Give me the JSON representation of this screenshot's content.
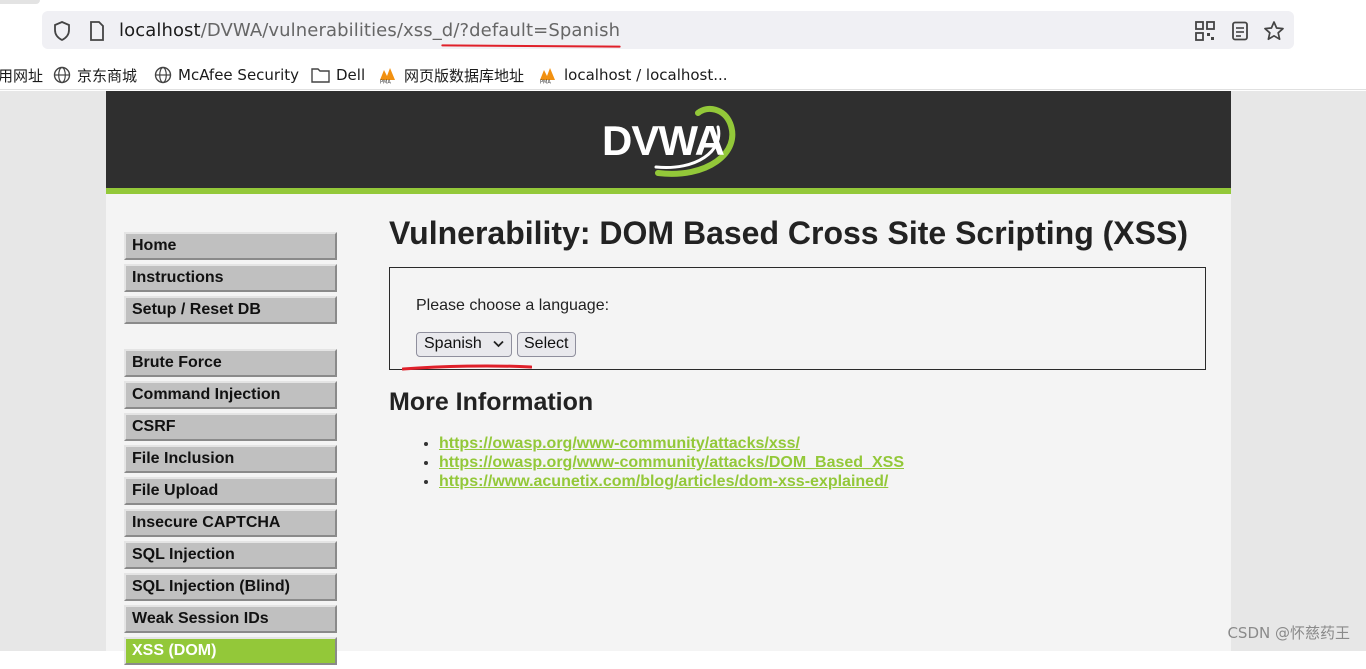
{
  "browser": {
    "url_host": "localhost",
    "url_path": "/DVWA/vulnerabilities/xss_d/?default=Spanish",
    "bookmarks": [
      {
        "label": "用网址",
        "icon": "none"
      },
      {
        "label": "京东商城",
        "icon": "globe-icon"
      },
      {
        "label": "McAfee Security",
        "icon": "globe-icon"
      },
      {
        "label": "Dell",
        "icon": "folder-icon"
      },
      {
        "label": "网页版数据库地址",
        "icon": "pma-icon"
      },
      {
        "label": "localhost / localhost...",
        "icon": "pma-icon"
      }
    ]
  },
  "header": {
    "logo_text": "DVWA"
  },
  "menu": {
    "group1": [
      "Home",
      "Instructions",
      "Setup / Reset DB"
    ],
    "group2": [
      "Brute Force",
      "Command Injection",
      "CSRF",
      "File Inclusion",
      "File Upload",
      "Insecure CAPTCHA",
      "SQL Injection",
      "SQL Injection (Blind)",
      "Weak Session IDs",
      "XSS (DOM)"
    ],
    "selected": "XSS (DOM)"
  },
  "main": {
    "title": "Vulnerability: DOM Based Cross Site Scripting (XSS)",
    "prompt": "Please choose a language:",
    "language_selected": "Spanish",
    "select_button": "Select",
    "more_info_title": "More Information",
    "links": [
      "https://owasp.org/www-community/attacks/xss/",
      "https://owasp.org/www-community/attacks/DOM_Based_XSS",
      "https://www.acunetix.com/blog/articles/dom-xss-explained/"
    ]
  },
  "watermark": "CSDN @怀慈药王",
  "colors": {
    "accent": "#93c839",
    "header_bg": "#2f2f2f",
    "annotation_red": "#e0202a"
  }
}
